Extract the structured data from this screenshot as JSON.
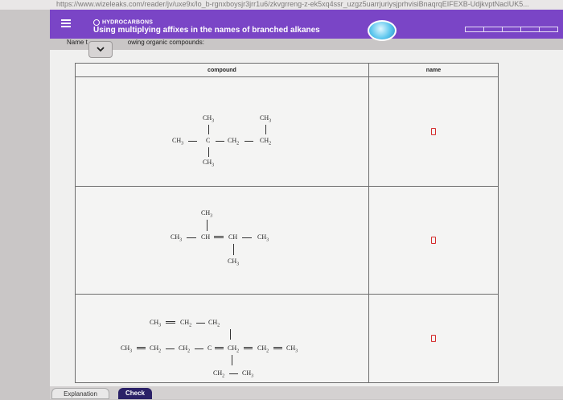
{
  "browser": {
    "url": "https://www.wizeleaks.com/reader/jv/uxe9x/lo_b-rgnxboysjr3jrr1u6/zkvgrreng-z-ek5xq4ssr_uzgz5uarrjuriysjprhvisiBnaqrqEIFEXB-UdjkvptNaclUK5..."
  },
  "header": {
    "menu_icon": "hamburger-menu-icon",
    "topic": "HYDROCARBONS",
    "title": "Using multiplying affixes in the names of branched alkanes",
    "status_icon": "status-oval-icon",
    "progress_segments": 5
  },
  "prompt": {
    "lead": "Name t",
    "rest": "owing organic compounds:"
  },
  "table": {
    "col_compound": "compound",
    "col_name": "name",
    "rows": [
      {
        "top_left": "CH3",
        "top_right": "CH3",
        "chain": [
          "CH3",
          "C",
          "CH2",
          "CH2"
        ],
        "bottom": "CH3",
        "answer": ""
      },
      {
        "top": "CH3",
        "chain": [
          "CH3",
          "CH",
          "CH",
          "CH3"
        ],
        "bottom": "CH3",
        "answer": ""
      },
      {
        "top": [
          "CH3",
          "CH2",
          "CH2"
        ],
        "chain": [
          "CH3",
          "CH2",
          "CH2",
          "C",
          "CH2",
          "CH2",
          "CH3"
        ],
        "bottom": [
          "CH2",
          "CH3"
        ],
        "answer": ""
      }
    ]
  },
  "buttons": {
    "explanation": "Explanation",
    "check": "Check"
  },
  "colors": {
    "header": "#7a45c6",
    "check_button": "#2b2167",
    "answer_box_border": "#d42b2b"
  }
}
